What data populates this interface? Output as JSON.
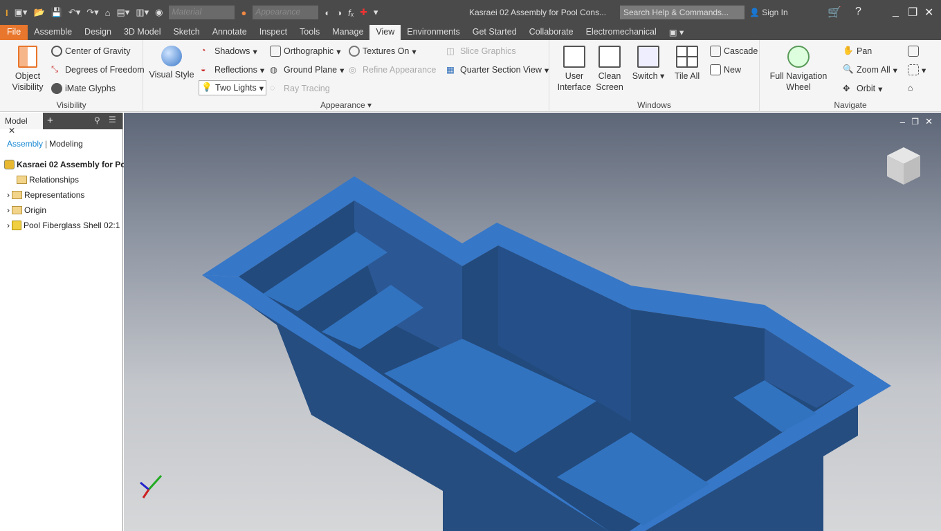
{
  "titlebar": {
    "material_placeholder": "Material",
    "appearance_placeholder": "Appearance",
    "document_title": "Kasraei 02 Assembly for Pool Cons...",
    "search_placeholder": "Search Help & Commands...",
    "sign_in": "Sign In"
  },
  "tabs": [
    "File",
    "Assemble",
    "Design",
    "3D Model",
    "Sketch",
    "Annotate",
    "Inspect",
    "Tools",
    "Manage",
    "View",
    "Environments",
    "Get Started",
    "Collaborate",
    "Electromechanical"
  ],
  "active_tab": "View",
  "ribbon": {
    "visibility": {
      "label": "Visibility",
      "object_visibility": "Object Visibility",
      "center_of_gravity": "Center of Gravity",
      "degrees_of_freedom": "Degrees of Freedom",
      "imate_glyphs": "iMate Glyphs"
    },
    "appearance": {
      "label": "Appearance ▾",
      "visual_style": "Visual Style",
      "shadows": "Shadows",
      "reflections": "Reflections",
      "two_lights": "Two Lights",
      "orthographic": "Orthographic",
      "ground_plane": "Ground Plane",
      "ray_tracing": "Ray Tracing",
      "textures_on": "Textures On",
      "refine_appearance": "Refine Appearance",
      "slice_graphics": "Slice Graphics",
      "quarter_section_view": "Quarter Section View"
    },
    "windows": {
      "label": "Windows",
      "user_interface": "User Interface",
      "clean_screen": "Clean Screen",
      "switch": "Switch",
      "tile_all": "Tile All",
      "cascade": "Cascade",
      "new": "New"
    },
    "navigate": {
      "label": "Navigate",
      "full_navigation_wheel": "Full Navigation Wheel",
      "pan": "Pan",
      "zoom_all": "Zoom All",
      "orbit": "Orbit"
    }
  },
  "browser": {
    "tab": "Model",
    "mode_assembly": "Assembly",
    "mode_modeling": "Modeling",
    "root": "Kasraei 02 Assembly for Po",
    "items": [
      "Relationships",
      "Representations",
      "Origin",
      "Pool Fiberglass Shell 02:1"
    ]
  },
  "colors": {
    "accent": "#e8762c",
    "model_blue": "#2f6fbf",
    "link_blue": "#1a8ad4"
  }
}
